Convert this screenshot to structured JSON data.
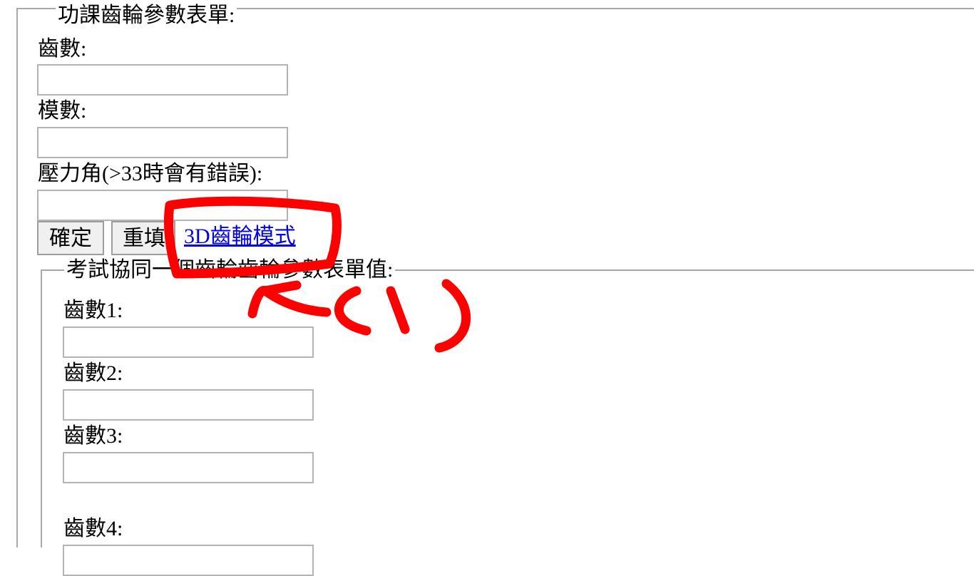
{
  "form": {
    "legend": "功課齒輪參數表單:",
    "teeth_label": "齒數:",
    "module_label": "模數:",
    "pressure_label": "壓力角(>33時會有錯誤):",
    "submit_label": "確定",
    "reset_label": "重填",
    "link_label": "3D齒輪模式"
  },
  "exam": {
    "legend": "考試協同一個齒輪齒輪參數表單值:",
    "teeth1_label": "齒數1:",
    "teeth2_label": "齒數2:",
    "teeth3_label": "齒數3:",
    "teeth4_label": "齒數4:"
  },
  "annotation": {
    "color": "#ff0000",
    "marker_text": "(1)"
  }
}
